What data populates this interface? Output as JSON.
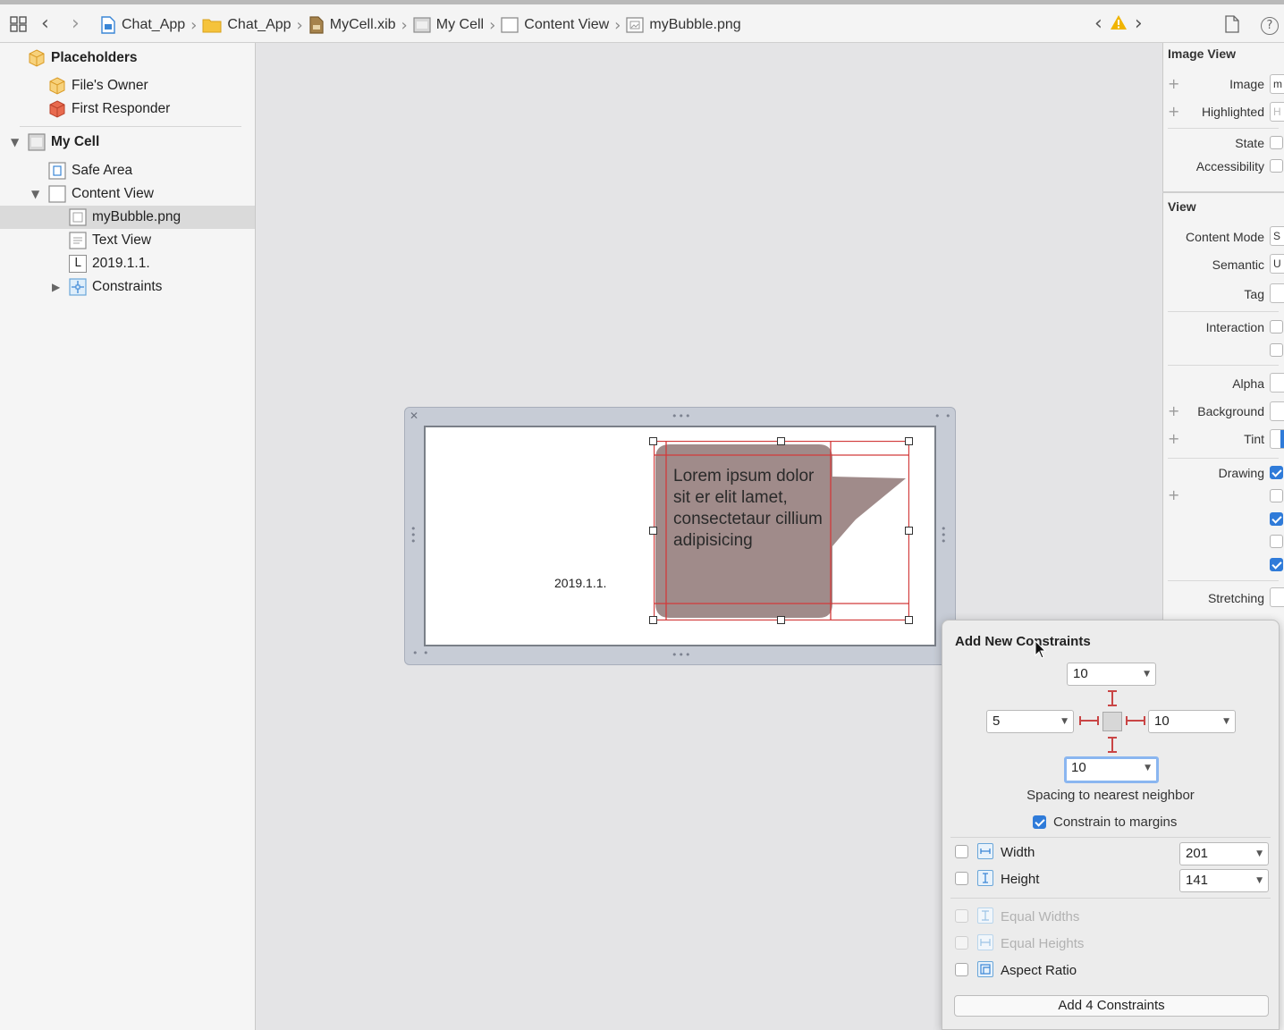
{
  "breadcrumbs": [
    {
      "label": "Chat_App",
      "icon": "project-file-icon"
    },
    {
      "label": "Chat_App",
      "icon": "folder-icon"
    },
    {
      "label": "MyCell.xib",
      "icon": "xib-file-icon"
    },
    {
      "label": "My Cell",
      "icon": "cell-icon"
    },
    {
      "label": "Content View",
      "icon": "view-icon"
    },
    {
      "label": "myBubble.png",
      "icon": "image-view-icon"
    }
  ],
  "outline": {
    "placeholders": "Placeholders",
    "files_owner": "File's Owner",
    "first_responder": "First Responder",
    "my_cell": "My Cell",
    "safe_area": "Safe Area",
    "content_view": "Content View",
    "my_bubble": "myBubble.png",
    "text_view": "Text View",
    "date_label": "2019.1.1.",
    "constraints": "Constraints",
    "label_badge": "L"
  },
  "canvas": {
    "date_text": "2019.1.1.",
    "bubble_text": "Lorem ipsum dolor sit er elit lamet, consectetaur cillium adipisicing"
  },
  "inspector": {
    "image_view_section": "Image View",
    "image": "Image",
    "image_value": "m",
    "highlighted": "Highlighted",
    "highlighted_value": "H",
    "state": "State",
    "accessibility": "Accessibility",
    "view_section": "View",
    "content_mode": "Content Mode",
    "content_mode_value": "S",
    "semantic": "Semantic",
    "semantic_value": "U",
    "tag": "Tag",
    "interaction": "Interaction",
    "alpha": "Alpha",
    "background": "Background",
    "tint": "Tint",
    "drawing": "Drawing",
    "stretching": "Stretching"
  },
  "popover": {
    "title": "Add New Constraints",
    "top": "10",
    "left": "5",
    "right": "10",
    "bottom": "10",
    "spacing_label": "Spacing to nearest neighbor",
    "constrain_margins": "Constrain to margins",
    "width": "Width",
    "width_value": "201",
    "height": "Height",
    "height_value": "141",
    "equal_widths": "Equal Widths",
    "equal_heights": "Equal Heights",
    "aspect_ratio": "Aspect Ratio",
    "add_button": "Add 4 Constraints"
  },
  "colors": {
    "accent": "#2f7bd9",
    "constraint_red": "#c94545",
    "bubble_fill": "#9b8584",
    "warning": "#f0b400"
  }
}
